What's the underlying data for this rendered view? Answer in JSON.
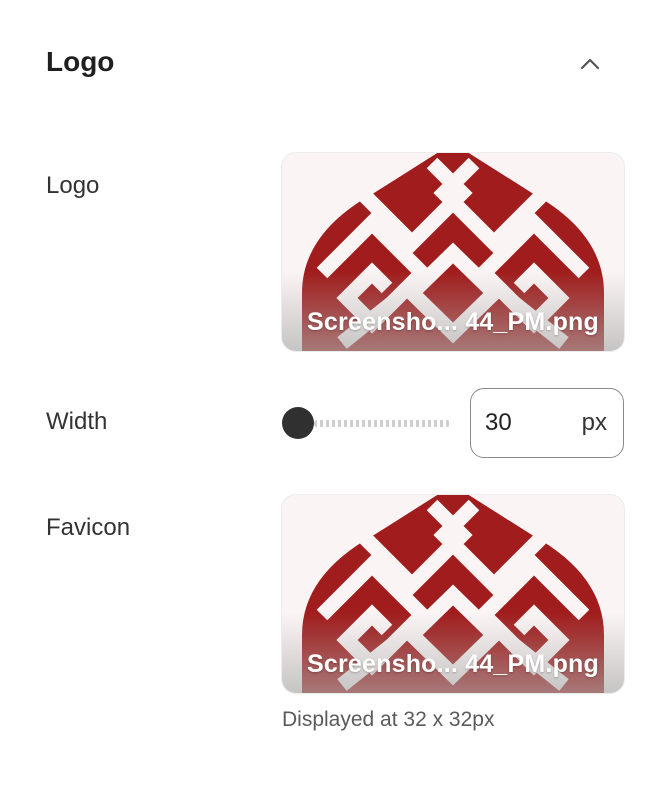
{
  "section": {
    "title": "Logo",
    "collapse_icon": "chevron-up-icon"
  },
  "logo": {
    "label": "Logo",
    "file_name": "Screensho... 44_PM.png"
  },
  "width": {
    "label": "Width",
    "value": "30",
    "unit": "px",
    "slider_level": 0
  },
  "favicon": {
    "label": "Favicon",
    "file_name": "Screensho... 44_PM.png",
    "hint": "Displayed at 32 x 32px"
  },
  "colors": {
    "artwork": "#a11d1d",
    "text": "#2a2a2a"
  }
}
